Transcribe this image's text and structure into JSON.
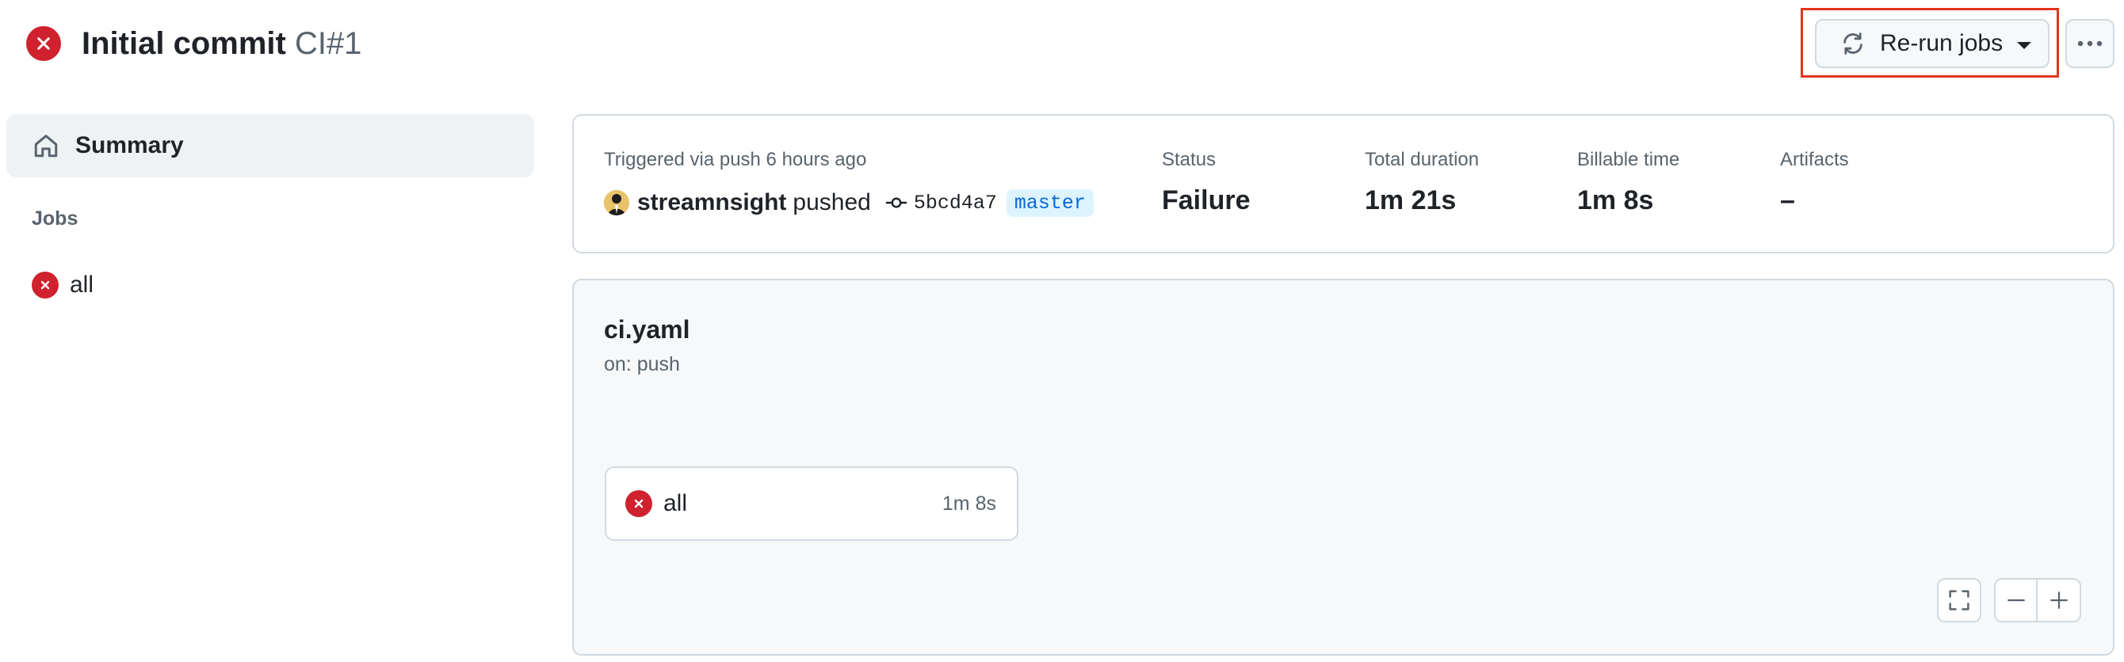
{
  "header": {
    "title": "Initial commit",
    "workflow": "CI",
    "run_number": "#1",
    "rerun_label": "Re-run jobs",
    "status_icon": "x-circle-fill-icon",
    "more_icon": "kebab-horizontal-icon"
  },
  "sidebar": {
    "summary_label": "Summary",
    "jobs_heading": "Jobs",
    "jobs": [
      {
        "name": "all",
        "status": "failure"
      }
    ]
  },
  "summary": {
    "trigger_text": "Triggered via push 6 hours ago",
    "actor": "streamnsight",
    "action": "pushed",
    "commit_sha": "5bcd4a7",
    "branch": "master",
    "status_label": "Status",
    "status_value": "Failure",
    "duration_label": "Total duration",
    "duration_value": "1m 21s",
    "billable_label": "Billable time",
    "billable_value": "1m 8s",
    "artifacts_label": "Artifacts",
    "artifacts_value": "–"
  },
  "graph": {
    "workflow_file": "ci.yaml",
    "trigger": "on: push",
    "jobs": [
      {
        "name": "all",
        "duration": "1m 8s",
        "status": "failure"
      }
    ]
  },
  "colors": {
    "failure": "#cf222e",
    "highlight": "#e5331d",
    "link": "#0969da",
    "muted": "#59636e"
  }
}
